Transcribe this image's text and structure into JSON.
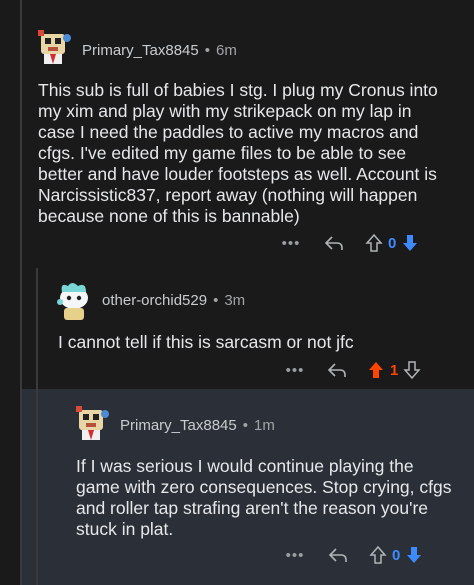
{
  "comments": [
    {
      "username": "Primary_Tax8845",
      "time": "6m",
      "body": "This sub is full of babies I stg. I plug my Cronus into my xim and play with my strikepack on my lap in case I need the paddles to active my macros and cfgs. I've edited my game files to be able to see better and have louder footsteps as well. Account is Narcissistic837, report away (nothing will happen because none of this is bannable)",
      "score": "0",
      "more": "•••"
    },
    {
      "username": "other-orchid529",
      "time": "3m",
      "body": "I cannot tell if this is sarcasm or not jfc",
      "score": "1",
      "more": "•••"
    },
    {
      "username": "Primary_Tax8845",
      "time": "1m",
      "body": "If I was serious I would continue playing the game with zero consequences. Stop crying, cfgs and roller tap strafing aren't the reason you're stuck in plat.",
      "score": "0",
      "more": "•••"
    }
  ],
  "separator": "•",
  "colors": {
    "background": "#1a1a1b",
    "highlight": "#2b3038",
    "upvote_active": "#ff4500",
    "downvote_active": "#3d8bff",
    "score_blue": "#3d8bff",
    "score_orange": "#ff4500"
  }
}
